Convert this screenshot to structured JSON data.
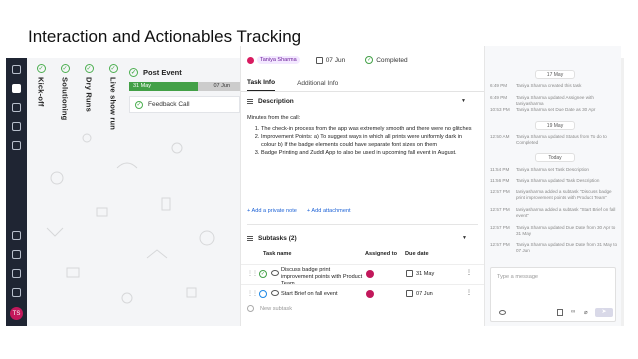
{
  "slide": {
    "title": "Interaction and Actionables Tracking"
  },
  "rail": {
    "avatar_initials": "TS"
  },
  "board": {
    "stages": [
      "Kick-off",
      "Solutioning",
      "Dry Runs",
      "Live show run"
    ],
    "post_event": "Post Event",
    "timeline": {
      "start_date": "31 May",
      "end_date": "07 Jun",
      "progress": 0.62
    },
    "card": "Feedback Call"
  },
  "task": {
    "assignee": "Taniya Sharma",
    "due": "07 Jun",
    "status": "Completed",
    "tabs": [
      "Task Info",
      "Additional Info"
    ],
    "description_title": "Description",
    "description_intro": "Minutes from the call:",
    "description_points": [
      "The check-in process from the app was extremely smooth and there were no glitches",
      "Improvement Points: a) To suggest ways in which all prints were uniformly dark in colour b) If the badge elements could have separate font sizes on them",
      "Badge Printing and Zuddl App to also be used in upcoming fall event in August."
    ],
    "add_private_note": "+ Add a private note",
    "add_attachment": "+ Add attachment",
    "subtasks_title": "Subtasks (2)",
    "subtask_columns": {
      "name": "Task name",
      "assigned": "Assigned to",
      "due": "Due date"
    },
    "subtasks": [
      {
        "name": "Discuss badge print improvement points with Product Team",
        "due": "31 May"
      },
      {
        "name": "Start Brief on fall event",
        "due": "07 Jun"
      }
    ],
    "new_subtask": "New subtask"
  },
  "activity": {
    "dates": [
      "17 May",
      "19 May",
      "Today"
    ],
    "entries_group1": [
      {
        "time": "6:49 PM",
        "text": "Taniya Sharma created this task"
      },
      {
        "time": "6:49 PM",
        "text": "Taniya Sharma updated Assignee with taniyasharma"
      },
      {
        "time": "10:53 PM",
        "text": "Taniya Sharma set Due Date as 30 Apr"
      }
    ],
    "entries_group2": [
      {
        "time": "12:50 AM",
        "text": "Taniya Sharma updated Status from To do to Completed"
      }
    ],
    "entries_group3": [
      {
        "time": "11:54 PM",
        "text": "Taniya Sharma set Task Description"
      },
      {
        "time": "11:56 PM",
        "text": "Taniya Sharma updated Task Description"
      },
      {
        "time": "12:57 PM",
        "text": "taniyasharma added a subtask \"Discuss badge print improvement points with Product Team\""
      },
      {
        "time": "12:57 PM",
        "text": "taniyasharma added a subtask \"Start Brief on fall event\""
      },
      {
        "time": "12:57 PM",
        "text": "Taniya Sharma updated Due Date from 30 Apr to 31 May"
      },
      {
        "time": "12:57 PM",
        "text": "Taniya Sharma updated Due Date from 31 May to 07 Jun"
      }
    ],
    "message_placeholder": "Type a message"
  },
  "colors": {
    "accent_green": "#43a047",
    "link_blue": "#1e63d6",
    "rail": "#1f2533",
    "avatar": "#c2185b"
  }
}
